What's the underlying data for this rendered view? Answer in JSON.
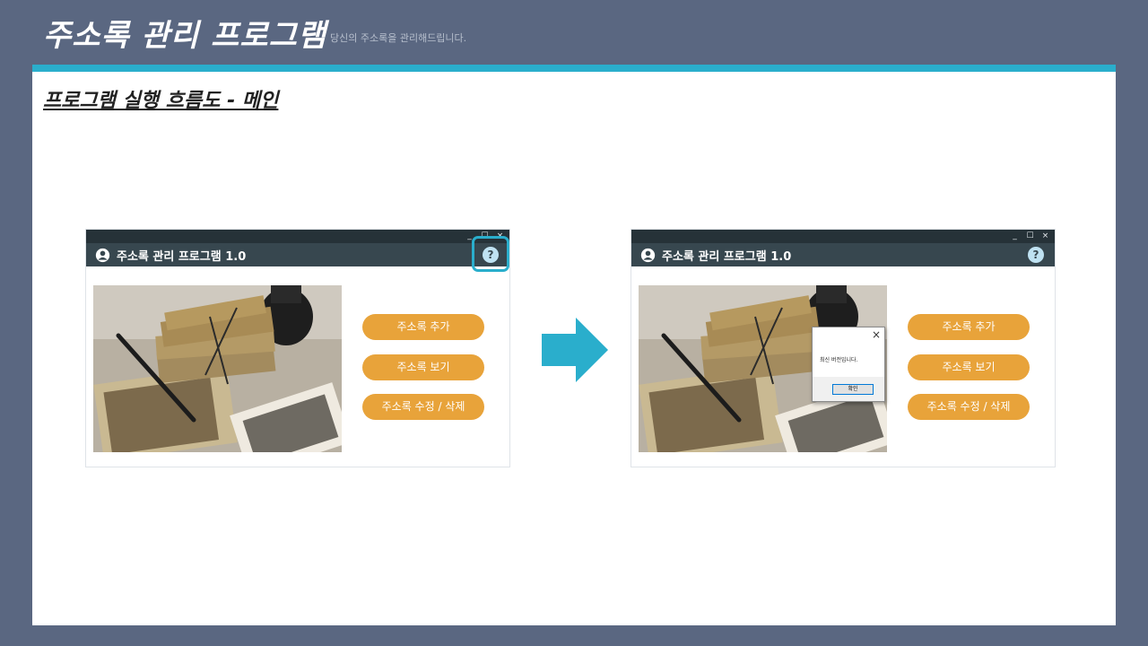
{
  "slide": {
    "title": "주소록 관리 프로그램",
    "subtitle": "당신의 주소록을 관리해드립니다."
  },
  "section": {
    "heading": "프로그램 실행 흐름도 - 메인"
  },
  "colors": {
    "background": "#5a6781",
    "accent": "#2aaecc",
    "app_titlebar": "#37474f",
    "app_chrome": "#263238",
    "menu_button": "#e8a33a",
    "help_button": "#bfe2f2"
  },
  "app": {
    "title": "주소록 관리 프로그램 1.0",
    "user_icon": "user-circle-icon",
    "help_icon": "question-mark-icon",
    "help_symbol": "?",
    "window_controls": {
      "minimize": "_",
      "maximize": "☐",
      "close": "×"
    },
    "menu": [
      {
        "label": "주소록 추가"
      },
      {
        "label": "주소록 보기"
      },
      {
        "label": "주소록 수정 / 삭제"
      }
    ]
  },
  "dialog": {
    "message": "최신 버전입니다.",
    "ok_label": "확인",
    "close_symbol": "×"
  },
  "flow": {
    "arrow_icon": "right-arrow-icon"
  }
}
